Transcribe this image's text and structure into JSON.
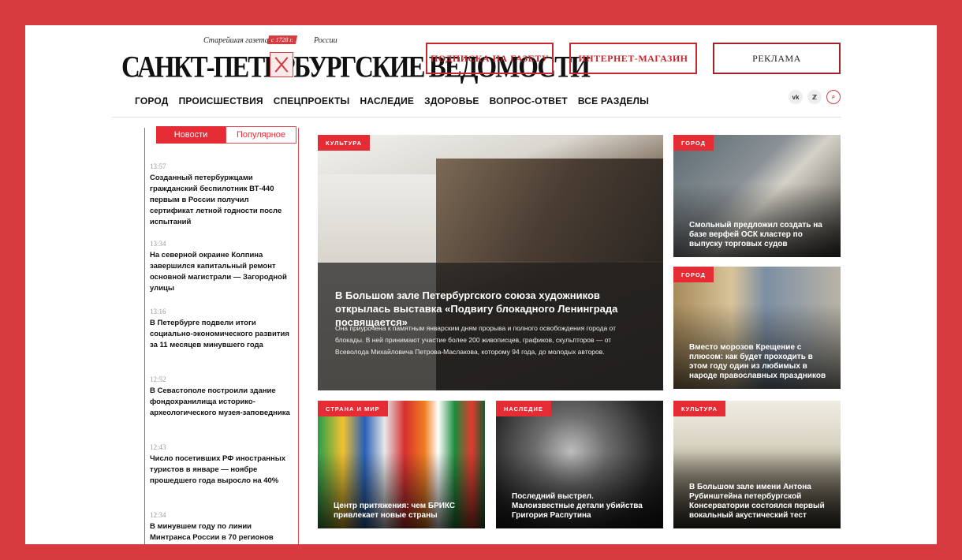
{
  "header": {
    "masthead_tag1": "Старейшая газета",
    "masthead_year": "с 1728 г.",
    "masthead_tag2": "России",
    "masthead_name": "САНКТ-ПЕТЕРБУРГСКИЕ ВЕДОМОСТИ",
    "btn_subscribe": "ПОДПИСКА НА ГАЗЕТУ",
    "btn_shop": "ИНТЕРНЕТ-МАГАЗИН",
    "btn_ads": "РЕКЛАМА"
  },
  "nav": [
    "ГОРОД",
    "ПРОИСШЕСТВИЯ",
    "СПЕЦПРОЕКТЫ",
    "НАСЛЕДИЕ",
    "ЗДОРОВЬЕ",
    "ВОПРОС-ОТВЕТ",
    "ВСЕ РАЗДЕЛЫ"
  ],
  "social": {
    "vk_icon": "vk-icon",
    "ok_icon": "ok-icon",
    "search_icon": "search-icon",
    "vk_label": "vk",
    "ok_label": "ℤ",
    "search_label": "⌕"
  },
  "tabs": {
    "news": "Новости",
    "popular": "Популярное"
  },
  "news": [
    {
      "time": "13:57",
      "title": "Созданный петербуржцами гражданский беспилотник ВТ-440 первым в России получил сертификат летной годности после испытаний"
    },
    {
      "time": "13:34",
      "title": "На северной окраине Колпина завершился капитальный ремонт основной магистрали — Загородной улицы"
    },
    {
      "time": "13:16",
      "title": "В Петербурге подвели итоги социально-экономического развития за 11 месяцев минувшего года"
    },
    {
      "time": "12:52",
      "title": "В Севастополе построили здание фондохранилища историко-археологического музея-заповедника"
    },
    {
      "time": "12:43",
      "title": "Число посетивших РФ иностранных туристов в январе — ноябре прошедшего года выросло на 40%"
    },
    {
      "time": "12:34",
      "title": "В минувшем году по линии Минтранса России в 70 регионов"
    }
  ],
  "cards": {
    "main": {
      "category": "КУЛЬТУРА",
      "title": "В Большом зале Петербургского союза художников открылась выставка «Подвигу блокадного Ленинграда посвящается»",
      "lead": "Она приурочена к памятным январским дням прорыва и полного освобождения города от блокады. В ней принимают участие более 200 живописцев, графиков, скульпторов — от Всеволода Михайловича Петрова-Маслакова, которому 94 года, до молодых авторов."
    },
    "c1": {
      "category": "ГОРОД",
      "title": "Смольный предложил создать на базе верфей ОСК кластер по выпуску торговых судов"
    },
    "c2": {
      "category": "ГОРОД",
      "title": "Вместо морозов Крещение с плюсом: как будет проходить в этом году один из любимых в народе православных праздников"
    },
    "c3": {
      "category": "СТРАНА И МИР",
      "title": "Центр притяжения: чем БРИКС привлекает новые страны"
    },
    "c4": {
      "category": "НАСЛЕДИЕ",
      "title": "Последний выстрел. Малоизвестные детали убийства Григория Распутина"
    },
    "c5": {
      "category": "КУЛЬТУРА",
      "title": "В Большом зале имени Антона Рубинштейна петербургской Консерватории состоялся первый вокальный акустический тест"
    }
  }
}
